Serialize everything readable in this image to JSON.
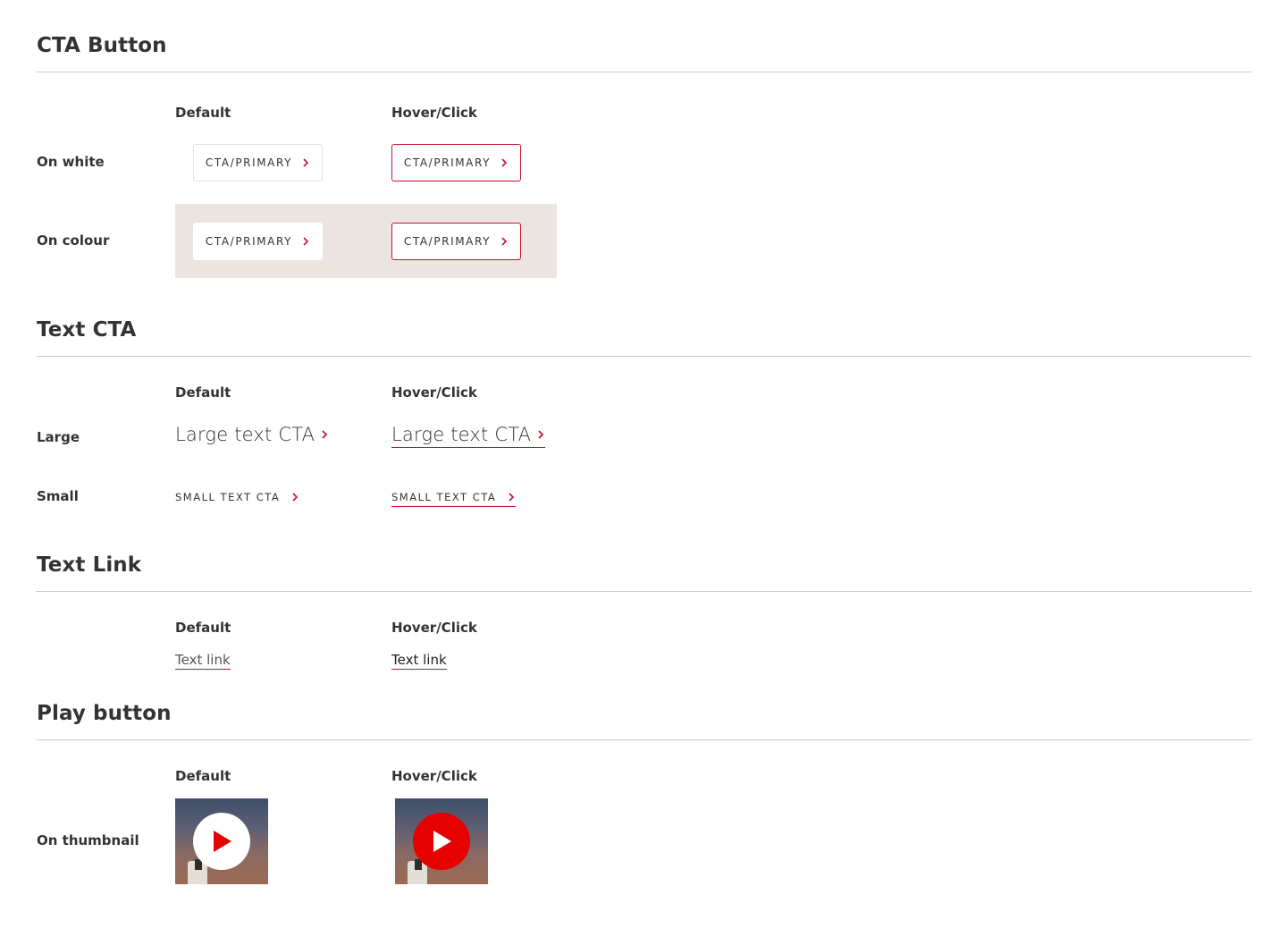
{
  "sections": {
    "cta_button": {
      "title": "CTA Button",
      "col_default": "Default",
      "col_hover": "Hover/Click",
      "row_on_white": "On white",
      "row_on_colour": "On colour",
      "button_label": "CTA/PRIMARY",
      "colour_band": "#ebe4e0"
    },
    "text_cta": {
      "title": "Text CTA",
      "col_default": "Default",
      "col_hover": "Hover/Click",
      "row_large": "Large",
      "row_small": "Small",
      "large_label": "Large text CTA",
      "small_label": "SMALL TEXT CTA"
    },
    "text_link": {
      "title": "Text Link",
      "col_default": "Default",
      "col_hover": "Hover/Click",
      "link_label": "Text link"
    },
    "play_button": {
      "title": "Play button",
      "col_default": "Default",
      "col_hover": "Hover/Click",
      "row_on_thumbnail": "On thumbnail"
    }
  },
  "colors": {
    "accent": "#c8102e",
    "play_hover": "#e60000",
    "rule": "#cccccc",
    "text": "#333333"
  },
  "icons": {
    "chevron": "chevron-right-icon",
    "play": "play-icon"
  }
}
